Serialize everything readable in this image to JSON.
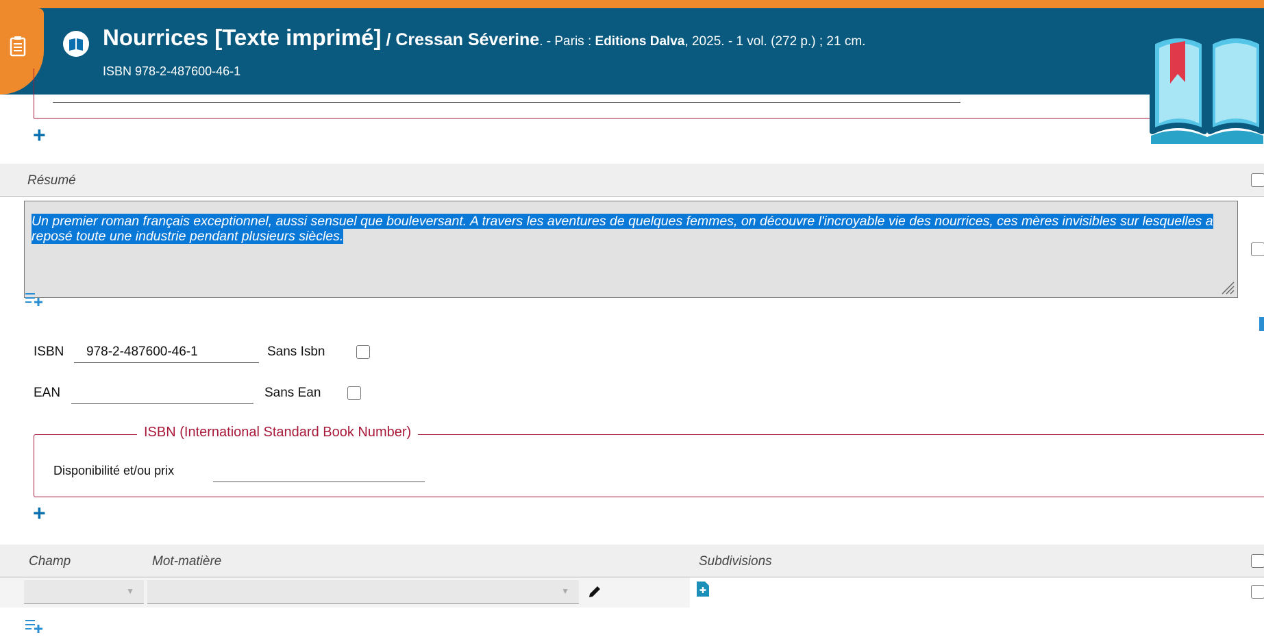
{
  "header": {
    "title": "Nourrices [Texte imprimé]",
    "author_sep": " / ",
    "author": "Cressan Séverine",
    "pub_pre": ". - Paris : ",
    "publisher": "Editions Dalva",
    "pub_post": ", 2025. - 1 vol. (272 p.) ; 21 cm.",
    "isbn_label": "ISBN",
    "isbn_value": "978-2-487600-46-1"
  },
  "resume": {
    "label": "Résumé",
    "text": "Un premier roman français exceptionnel, aussi sensuel que bouleversant. A travers les aventures de quelques femmes, on découvre l'incroyable vie des nourrices, ces mères invisibles sur lesquelles a reposé toute une industrie pendant plusieurs siècles."
  },
  "identifiers": {
    "isbn_label": "ISBN",
    "isbn_value": "978-2-487600-46-1",
    "sans_isbn_label": "Sans Isbn",
    "ean_label": "EAN",
    "ean_value": "",
    "sans_ean_label": "Sans Ean"
  },
  "isbn_group": {
    "legend": "ISBN (International Standard Book Number)",
    "dispo_label": "Disponibilité et/ou prix",
    "dispo_value": ""
  },
  "subjects": {
    "headers": [
      "Champ",
      "Mot-matière",
      "Subdivisions"
    ]
  },
  "colors": {
    "header_bg": "#0a5a80",
    "accent_orange": "#ef8a2c",
    "group_border": "#a8193a",
    "add_blue": "#0a6fae",
    "selection": "#0a78d7"
  },
  "icons": [
    "notes-icon",
    "book-icon",
    "open-book-logo-icon",
    "plus-icon",
    "list-add-icon",
    "pencil-icon",
    "add-file-icon",
    "resize-grip-icon"
  ]
}
